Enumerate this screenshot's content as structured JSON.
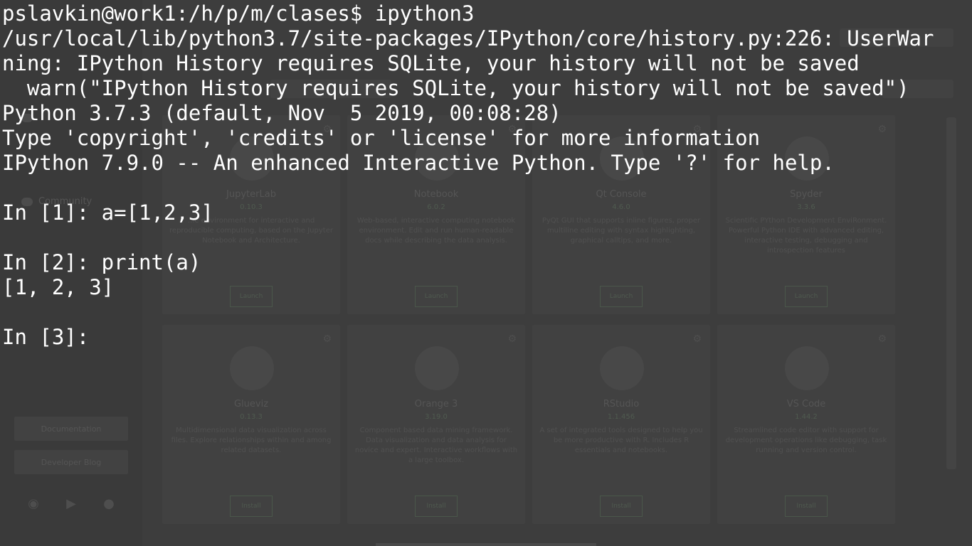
{
  "terminal": {
    "lines": [
      "pslavkin@work1:/h/p/m/clases$ ipython3",
      "/usr/local/lib/python3.7/site-packages/IPython/core/history.py:226: UserWar",
      "ning: IPython History requires SQLite, your history will not be saved",
      "  warn(\"IPython History requires SQLite, your history will not be saved\")",
      "Python 3.7.3 (default, Nov  5 2019, 00:08:28)",
      "Type 'copyright', 'credits' or 'license' for more information",
      "IPython 7.9.0 -- An enhanced Interactive Python. Type '?' for help.",
      "",
      "In [1]: a=[1,2,3]",
      "",
      "In [2]: print(a)",
      "[1, 2, 3]",
      "",
      "In [3]: "
    ],
    "text_color": "#ffffff"
  },
  "background_app": {
    "sidebar": {
      "community_label": "Community",
      "links": [
        "Documentation",
        "Developer Blog"
      ],
      "social_icons": [
        "twitter-icon",
        "youtube-icon",
        "github-icon"
      ]
    },
    "tiles": [
      {
        "name": "JupyterLab",
        "version": "0.10.3",
        "desc": "...e environment for interactive and reproducible computing, based on the Jupyter Notebook and Architecture.",
        "button": "Launch"
      },
      {
        "name": "Notebook",
        "version": "6.0.2",
        "desc": "Web-based, interactive computing notebook environment. Edit and run human-readable docs while describing the data analysis.",
        "button": "Launch"
      },
      {
        "name": "Qt Console",
        "version": "4.6.0",
        "desc": "PyQt GUI that supports inline figures, proper multiline editing with syntax highlighting, graphical calltips, and more.",
        "button": "Launch"
      },
      {
        "name": "Spyder",
        "version": "3.3.6",
        "desc": "Scientific PYthon Development EnviRonment. Powerful Python IDE with advanced editing, interactive testing, debugging and introspection features",
        "button": "Launch"
      },
      {
        "name": "Glueviz",
        "version": "0.13.3",
        "desc": "Multidimensional data visualization across files. Explore relationships within and among related datasets.",
        "button": "Install"
      },
      {
        "name": "Orange 3",
        "version": "3.19.0",
        "desc": "Component based data mining framework. Data visualization and data analysis for novice and expert. Interactive workflows with a large toolbox.",
        "button": "Install"
      },
      {
        "name": "RStudio",
        "version": "1.1.456",
        "desc": "A set of integrated tools designed to help you be more productive with R. Includes R essentials and notebooks.",
        "button": "Install"
      },
      {
        "name": "VS Code",
        "version": "1.44.2",
        "desc": "Streamlined code editor with support for development operations like debugging, task running and version control.",
        "button": "Install"
      }
    ]
  }
}
